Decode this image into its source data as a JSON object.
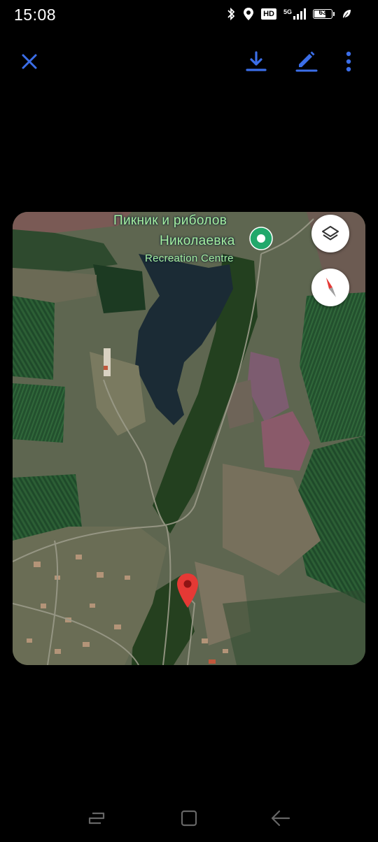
{
  "status_bar": {
    "time": "15:08",
    "hd_badge": "HD",
    "network_type": "5G",
    "battery_level": "63",
    "battery_fraction": 0.63,
    "icons": [
      "bluetooth-icon",
      "location-icon",
      "signal-icon",
      "leaf-icon"
    ]
  },
  "toolbar": {
    "icons": [
      "close-icon",
      "download-icon",
      "edit-icon",
      "more-vert-icon"
    ],
    "accent_color": "#3b6ee8"
  },
  "map": {
    "place_name_line1": "Пикник и риболов",
    "place_name_line2": "Николаевка",
    "place_category": "Recreation Centre",
    "label_color": "#a6f0a0",
    "poi_marker_color": "#22a86b",
    "pin_color": "#e53935",
    "controls": [
      "layers-icon",
      "compass-icon"
    ]
  },
  "nav_bar": {
    "icons": [
      "recents-icon",
      "home-icon",
      "back-icon"
    ]
  }
}
